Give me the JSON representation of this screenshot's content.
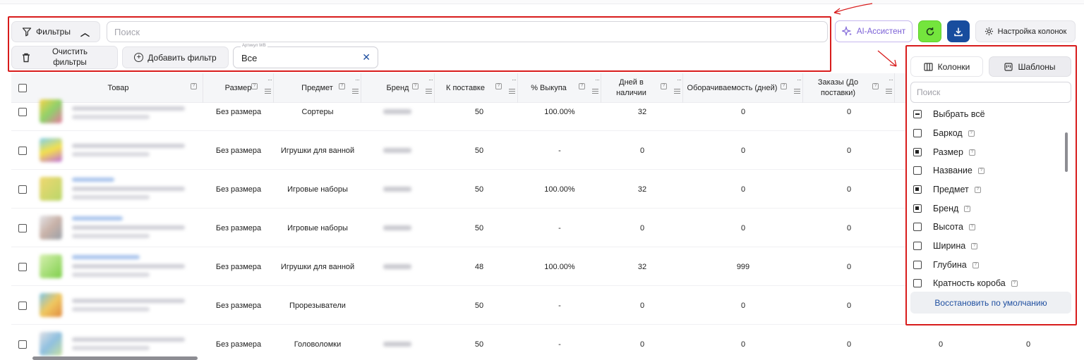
{
  "toolbar": {
    "filters_label": "Фильтры",
    "search_placeholder": "Поиск",
    "clear_filters_label": "Очистить фильтры",
    "add_filter_label": "Добавить фильтр",
    "article_field": {
      "label": "Артикул WB",
      "value": "Все"
    },
    "ai_assistant_label": "AI-Ассистент",
    "column_settings_label": "Настройка колонок",
    "colors": {
      "highlight": "#d81c1c",
      "refresh_bg": "#74e53d",
      "download_bg": "#184d9e",
      "ai_accent": "#7a5fd6"
    }
  },
  "table": {
    "headers": [
      "Товар",
      "Размер",
      "Предмет",
      "Бренд",
      "К поставке",
      "% Выкупа",
      "Дней в наличии",
      "Оборачиваемость (дней)",
      "Заказы (До поставки)"
    ],
    "rows": [
      {
        "size": "Без размера",
        "subject": "Сортеры",
        "supply": "50",
        "buyout": "100.00%",
        "days": "32",
        "turnover": "0",
        "orders": "0"
      },
      {
        "size": "Без размера",
        "subject": "Игрушки для ванной",
        "supply": "50",
        "buyout": "-",
        "days": "0",
        "turnover": "0",
        "orders": "0"
      },
      {
        "size": "Без размера",
        "subject": "Игровые наборы",
        "supply": "50",
        "buyout": "100.00%",
        "days": "32",
        "turnover": "0",
        "orders": "0"
      },
      {
        "size": "Без размера",
        "subject": "Игровые наборы",
        "supply": "50",
        "buyout": "-",
        "days": "0",
        "turnover": "0",
        "orders": "0"
      },
      {
        "size": "Без размера",
        "subject": "Игрушки для ванной",
        "supply": "48",
        "buyout": "100.00%",
        "days": "32",
        "turnover": "999",
        "orders": "0"
      },
      {
        "size": "Без размера",
        "subject": "Прорезыватели",
        "supply": "50",
        "buyout": "-",
        "days": "0",
        "turnover": "0",
        "orders": "0"
      },
      {
        "size": "Без размера",
        "subject": "Головоломки",
        "supply": "50",
        "buyout": "-",
        "days": "0",
        "turnover": "0",
        "orders": "0"
      }
    ],
    "trailing_values": [
      "0",
      "0"
    ]
  },
  "column_panel": {
    "tabs": [
      "Колонки",
      "Шаблоны"
    ],
    "search_placeholder": "Поиск",
    "options": [
      {
        "label": "Выбрать всё",
        "state": "partial"
      },
      {
        "label": "Баркод",
        "state": "unchecked"
      },
      {
        "label": "Размер",
        "state": "checked"
      },
      {
        "label": "Название",
        "state": "unchecked"
      },
      {
        "label": "Предмет",
        "state": "checked"
      },
      {
        "label": "Бренд",
        "state": "checked"
      },
      {
        "label": "Высота",
        "state": "unchecked"
      },
      {
        "label": "Ширина",
        "state": "unchecked"
      },
      {
        "label": "Глубина",
        "state": "unchecked"
      },
      {
        "label": "Кратность короба",
        "state": "unchecked"
      }
    ],
    "restore_label": "Восстановить по умолчанию"
  }
}
